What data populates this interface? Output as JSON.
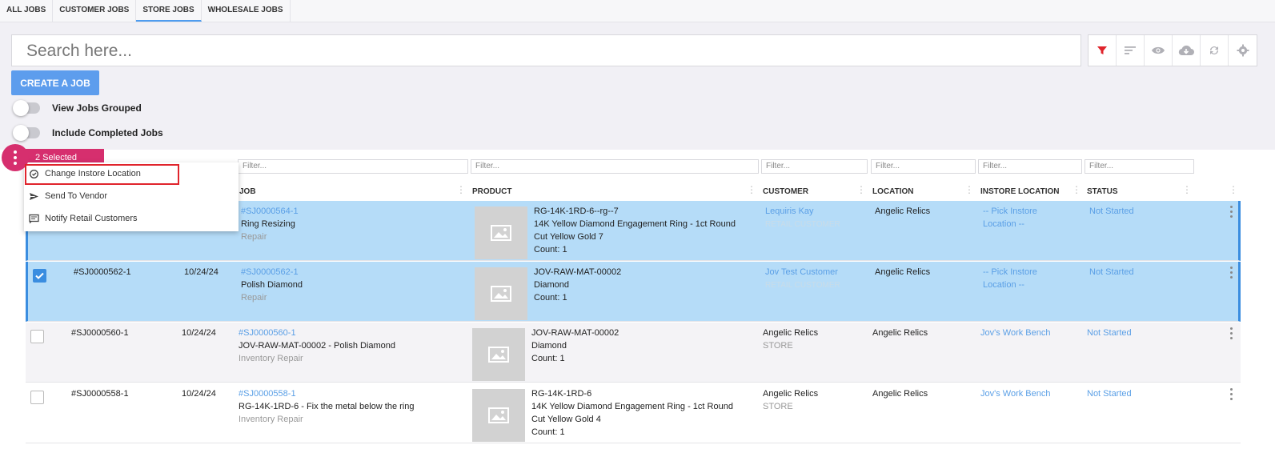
{
  "tabs": [
    "ALL JOBS",
    "CUSTOMER JOBS",
    "STORE JOBS",
    "WHOLESALE JOBS"
  ],
  "active_tab": "STORE JOBS",
  "search": {
    "placeholder": "Search here..."
  },
  "toolbar": {
    "icons": [
      "filter-icon",
      "sort-icon",
      "eye-icon",
      "cloud-download-icon",
      "refresh-icon",
      "gear-icon"
    ],
    "filter_color": "#e0242c"
  },
  "create_button": "CREATE A JOB",
  "toggles": {
    "view_grouped": "View Jobs Grouped",
    "include_completed": "Include Completed Jobs"
  },
  "selection": {
    "label": "2 Selected"
  },
  "context_menu": {
    "items": [
      "Change Instore Location",
      "Send To Vendor",
      "Notify Retail Customers"
    ]
  },
  "filter_placeholder": "Filter...",
  "columns": {
    "job": "JOB",
    "product": "PRODUCT",
    "customer": "CUSTOMER",
    "location": "LOCATION",
    "instore_location": "INSTORE LOCATION",
    "status": "STATUS"
  },
  "rows": [
    {
      "id": "",
      "date": "",
      "job_link": "#SJ0000564-1",
      "job_title": "Ring Resizing",
      "job_type": "Repair",
      "product_sku": "RG-14K-1RD-6--rg--7",
      "product_line2": "14K Yellow Diamond Engagement Ring - 1ct Round",
      "product_line3": "Cut Yellow Gold 7",
      "product_count": "Count: 1",
      "customer": "Lequiris Kay",
      "customer_type": "RETAIL CUSTOMER",
      "location": "Angelic Relics",
      "instore_1": "-- Pick Instore",
      "instore_2": "Location --",
      "status": "Not Started",
      "checked": true
    },
    {
      "id": "#SJ0000562-1",
      "date": "10/24/24",
      "job_link": "#SJ0000562-1",
      "job_title": "Polish Diamond",
      "job_type": "Repair",
      "product_sku": "JOV-RAW-MAT-00002",
      "product_line2": "Diamond",
      "product_line3": "",
      "product_count": "Count: 1",
      "customer": "Jov Test Customer",
      "customer_type": "RETAIL CUSTOMER",
      "location": "Angelic Relics",
      "instore_1": "-- Pick Instore",
      "instore_2": "Location --",
      "status": "Not Started",
      "checked": true
    },
    {
      "id": "#SJ0000560-1",
      "date": "10/24/24",
      "job_link": "#SJ0000560-1",
      "job_title": "JOV-RAW-MAT-00002 - Polish Diamond",
      "job_type": "Inventory Repair",
      "product_sku": "JOV-RAW-MAT-00002",
      "product_line2": "Diamond",
      "product_line3": "",
      "product_count": "Count: 1",
      "customer": "Angelic Relics",
      "customer_type": "STORE",
      "location": "Angelic Relics",
      "instore_1": "Jov's Work Bench",
      "instore_2": "",
      "status": "Not Started",
      "checked": false
    },
    {
      "id": "#SJ0000558-1",
      "date": "10/24/24",
      "job_link": "#SJ0000558-1",
      "job_title": "RG-14K-1RD-6 - Fix the metal below the ring",
      "job_type": "Inventory Repair",
      "product_sku": "RG-14K-1RD-6",
      "product_line2": "14K Yellow Diamond Engagement Ring - 1ct Round",
      "product_line3": "Cut Yellow Gold 4",
      "product_count": "Count: 1",
      "customer": "Angelic Relics",
      "customer_type": "STORE",
      "location": "Angelic Relics",
      "instore_1": "Jov's Work Bench",
      "instore_2": "",
      "status": "Not Started",
      "checked": false
    }
  ]
}
